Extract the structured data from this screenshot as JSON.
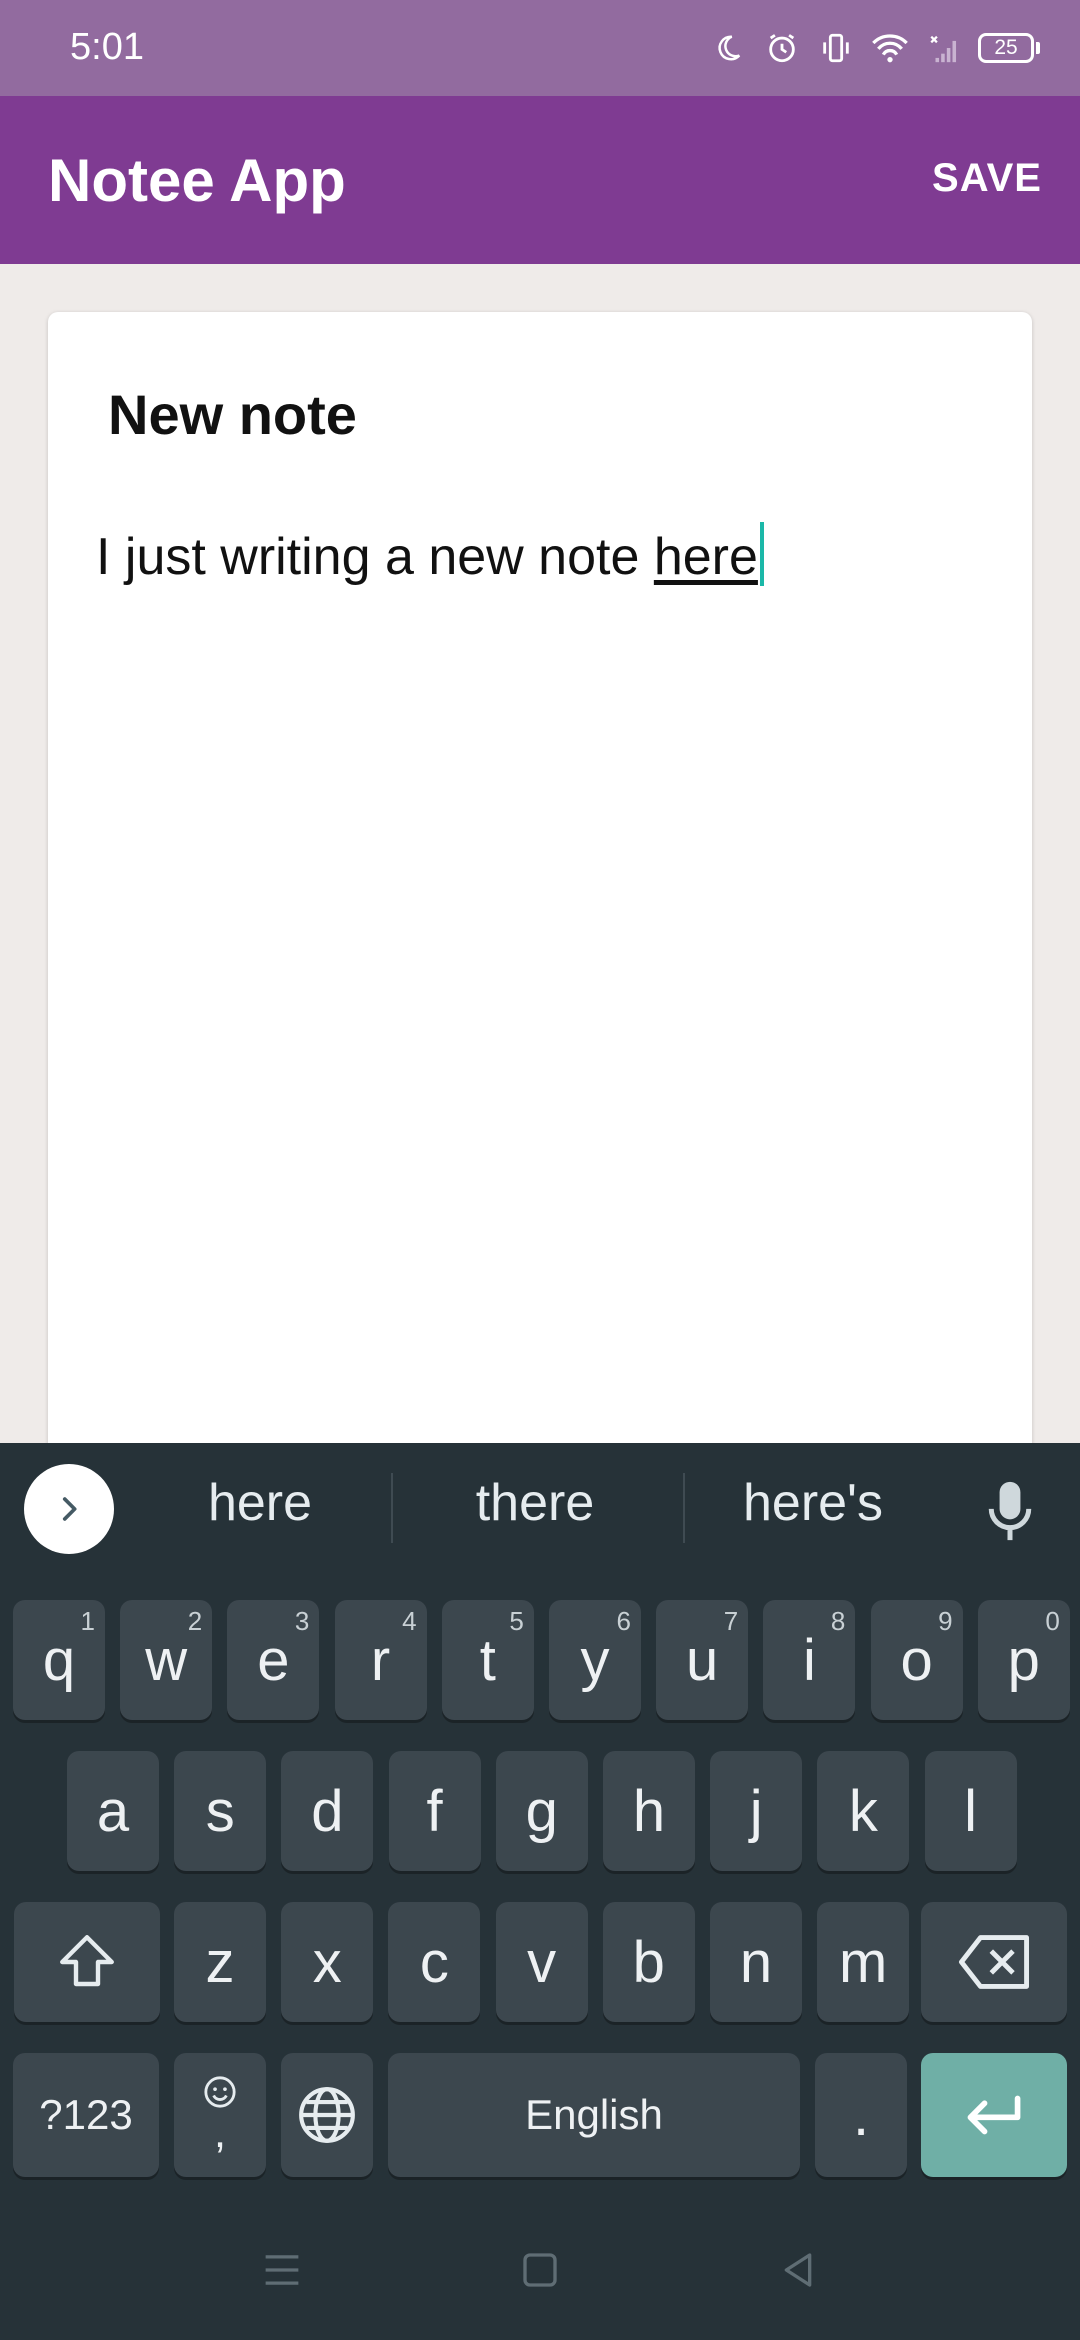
{
  "status_bar": {
    "time": "5:01",
    "battery": "25",
    "icons": [
      "moon-icon",
      "alarm-icon",
      "vibrate-icon",
      "wifi-icon",
      "signal-icon",
      "battery-icon"
    ]
  },
  "app_bar": {
    "title": "Notee App",
    "save_label": "SAVE",
    "color": "#7f3b92"
  },
  "note": {
    "title": "New note",
    "body_prefix": "I just writing a new note ",
    "body_composing": "here"
  },
  "keyboard": {
    "suggestions": [
      "here",
      "there",
      "here's"
    ],
    "row1": [
      {
        "key": "q",
        "hint": "1"
      },
      {
        "key": "w",
        "hint": "2"
      },
      {
        "key": "e",
        "hint": "3"
      },
      {
        "key": "r",
        "hint": "4"
      },
      {
        "key": "t",
        "hint": "5"
      },
      {
        "key": "y",
        "hint": "6"
      },
      {
        "key": "u",
        "hint": "7"
      },
      {
        "key": "i",
        "hint": "8"
      },
      {
        "key": "o",
        "hint": "9"
      },
      {
        "key": "p",
        "hint": "0"
      }
    ],
    "row2": [
      "a",
      "s",
      "d",
      "f",
      "g",
      "h",
      "j",
      "k",
      "l"
    ],
    "row3": [
      "z",
      "x",
      "c",
      "v",
      "b",
      "n",
      "m"
    ],
    "symbols_label": "?123",
    "comma_label": ",",
    "space_label": "English",
    "period_label": ".",
    "accent_color": "#6fafa6"
  }
}
